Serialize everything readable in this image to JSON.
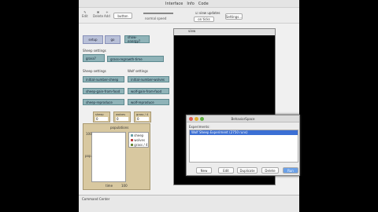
{
  "tabs": [
    "Interface",
    "Info",
    "Code"
  ],
  "toolbar": {
    "edit": "Edit",
    "delete": "Delete",
    "add": "Add",
    "add_select": "button",
    "speed_label": "normal speed",
    "view_updates": "view updates",
    "update_mode": "on ticks",
    "settings": "Settings..."
  },
  "buttons": {
    "setup": "setup",
    "go": "go",
    "show_energy": "show-energy?"
  },
  "labels": {
    "sheep_settings": "Sheep settings",
    "wolf_settings": "Wolf settings"
  },
  "sheep_controls": [
    "initial-number-sheep",
    "sheep-gain-from-food",
    "sheep-reproduce"
  ],
  "wolf_controls": [
    "initial-number-wolves",
    "wolf-gain-from-food",
    "wolf-reproduce"
  ],
  "grass": {
    "label": "grass?",
    "regrowth": "grass-regrowth-time"
  },
  "monitors": [
    {
      "label": "sheep",
      "value": "0"
    },
    {
      "label": "wolves",
      "value": "0"
    },
    {
      "label": "grass / 4",
      "value": "0"
    }
  ],
  "plot": {
    "title": "populations",
    "ylabel": "pop.",
    "xlabel": "time",
    "ymax": "100",
    "xmax": "100",
    "legend": [
      "sheep",
      "wolves",
      "grass / 4"
    ]
  },
  "world_title": "view",
  "dialog": {
    "title": "BehaviorSpace",
    "experiments_label": "Experiments:",
    "experiment": "Wolf Sheep Experiment (2750 runs)",
    "buttons": [
      "New",
      "Edit",
      "Duplicate",
      "Delete",
      "Run"
    ]
  },
  "command_center": "Command Center",
  "colors": {
    "sheep": "#6aa1a8",
    "wolves": "#c04040",
    "grass": "#6a8a3a"
  }
}
